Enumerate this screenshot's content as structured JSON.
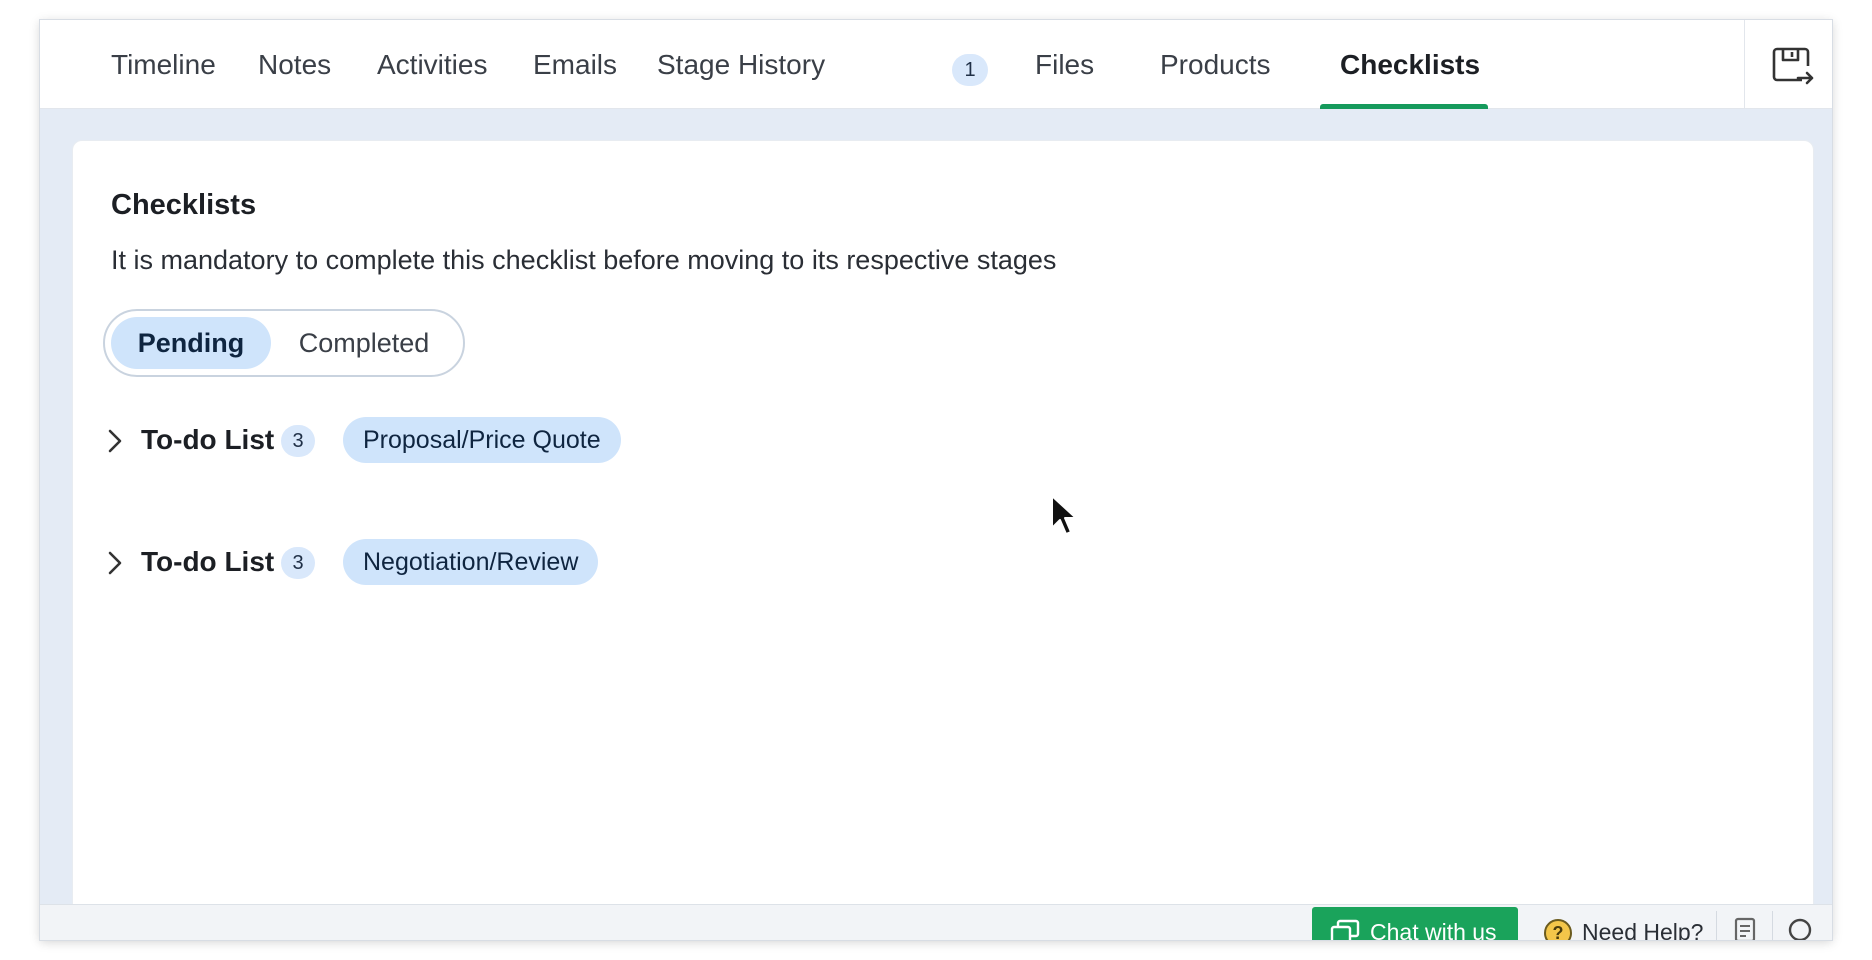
{
  "tabs": [
    {
      "label": "Timeline"
    },
    {
      "label": "Notes"
    },
    {
      "label": "Activities"
    },
    {
      "label": "Emails"
    },
    {
      "label": "Stage History",
      "count": "1"
    },
    {
      "label": "Files"
    },
    {
      "label": "Products"
    },
    {
      "label": "Checklists",
      "active": true
    }
  ],
  "header_icon": "export-icon",
  "card": {
    "title": "Checklists",
    "subtitle": "It is mandatory to complete this checklist before moving to its respective stages"
  },
  "filter": {
    "options": [
      "Pending",
      "Completed"
    ],
    "selected": "Pending"
  },
  "checklists": [
    {
      "title": "To-do List",
      "count": "3",
      "stage": "Proposal/Price Quote"
    },
    {
      "title": "To-do List",
      "count": "3",
      "stage": "Negotiation/Review"
    }
  ],
  "footer": {
    "chat_label": "Chat with us",
    "help_label": "Need Help?"
  },
  "colors": {
    "accent": "#159a5c",
    "chip_bg": "#cfe4fb",
    "page_bg": "#e4ebf5",
    "chat_button": "#1aa35b"
  }
}
